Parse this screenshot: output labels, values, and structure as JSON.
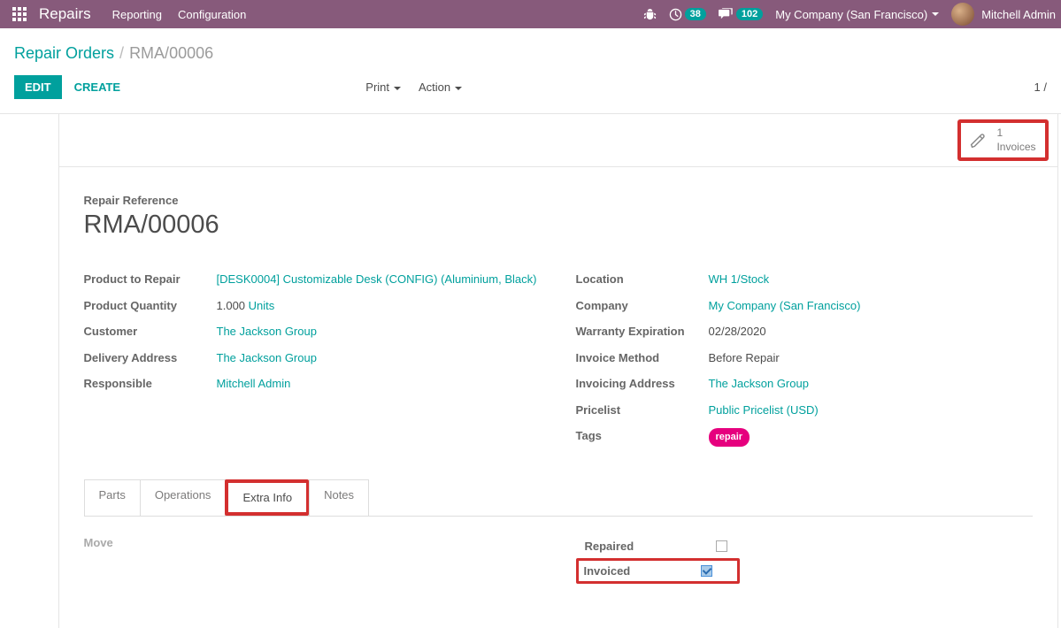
{
  "nav": {
    "brand": "Repairs",
    "menu": [
      "Reporting",
      "Configuration"
    ],
    "badge_clock": "38",
    "badge_chat": "102",
    "company": "My Company (San Francisco)",
    "user": "Mitchell Admin"
  },
  "breadcrumb": {
    "root": "Repair Orders",
    "current": "RMA/00006"
  },
  "controls": {
    "edit": "EDIT",
    "create": "CREATE",
    "print": "Print",
    "action": "Action",
    "pager": "1 /"
  },
  "stat": {
    "count": "1",
    "label": "Invoices"
  },
  "form": {
    "ref_label": "Repair Reference",
    "ref_value": "RMA/00006",
    "left": {
      "product_label": "Product to Repair",
      "product_value": "[DESK0004] Customizable Desk (CONFIG) (Aluminium, Black)",
      "qty_label": "Product Quantity",
      "qty_value": "1.000",
      "qty_units": "Units",
      "customer_label": "Customer",
      "customer_value": "The Jackson Group",
      "delivery_label": "Delivery Address",
      "delivery_value": "The Jackson Group",
      "responsible_label": "Responsible",
      "responsible_value": "Mitchell Admin"
    },
    "right": {
      "location_label": "Location",
      "location_value": "WH 1/Stock",
      "company_label": "Company",
      "company_value": "My Company (San Francisco)",
      "warranty_label": "Warranty Expiration",
      "warranty_value": "02/28/2020",
      "invmethod_label": "Invoice Method",
      "invmethod_value": "Before Repair",
      "invaddr_label": "Invoicing Address",
      "invaddr_value": "The Jackson Group",
      "pricelist_label": "Pricelist",
      "pricelist_value": "Public Pricelist (USD)",
      "tags_label": "Tags",
      "tags_value": "repair"
    }
  },
  "tabs": {
    "parts": "Parts",
    "operations": "Operations",
    "extra": "Extra Info",
    "notes": "Notes"
  },
  "extra": {
    "move": "Move",
    "repaired": "Repaired",
    "invoiced": "Invoiced"
  }
}
